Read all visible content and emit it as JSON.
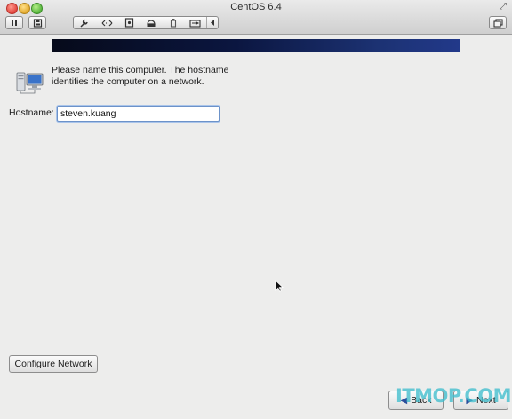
{
  "window": {
    "title": "CentOS 6.4"
  },
  "toolbar": {
    "icons": [
      "pause-icon",
      "snapshot-icon",
      "settings-wrench-icon",
      "network-arrows-icon",
      "disk-icon",
      "cd-drive-icon",
      "usb-icon",
      "shared-folder-icon",
      "chevron-left-icon",
      "window-icon",
      "fullscreen-icon"
    ]
  },
  "installer": {
    "intro_text": "Please name this computer.  The hostname identifies the computer on a network.",
    "hostname_label": "Hostname:",
    "hostname_value": "steven.kuang",
    "configure_network_label": "Configure Network",
    "back_label": "Back",
    "next_label": "Next"
  },
  "colors": {
    "banner_dark": "#060a1a",
    "banner_light": "#22398a",
    "input_focus": "#6c92c9",
    "window_bg": "#ededec"
  },
  "watermark": {
    "text": "ITMOP.COM"
  }
}
